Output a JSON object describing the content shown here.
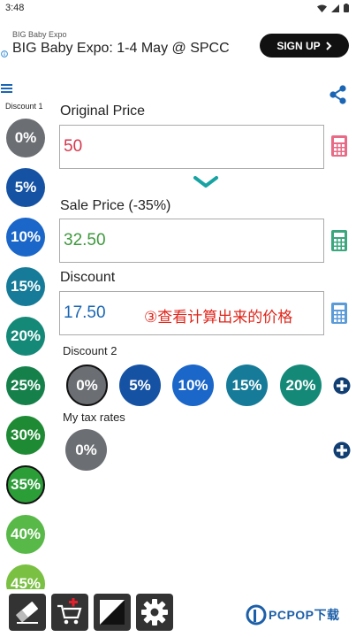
{
  "status": {
    "time": "3:48"
  },
  "ad": {
    "small_label": "BIG Baby Expo",
    "title": "BIG Baby Expo: 1-4 May @ SPCC",
    "info_icon": "info-icon",
    "cta": "SIGN UP"
  },
  "sidebar": {
    "label": "Discount 1",
    "items": [
      {
        "label": "0%",
        "color": "#6b6e72"
      },
      {
        "label": "5%",
        "color": "#1552a3"
      },
      {
        "label": "10%",
        "color": "#1a66c9"
      },
      {
        "label": "15%",
        "color": "#157b98"
      },
      {
        "label": "20%",
        "color": "#158978"
      },
      {
        "label": "25%",
        "color": "#15804a"
      },
      {
        "label": "30%",
        "color": "#1e8a33"
      },
      {
        "label": "35%",
        "color": "#2c9e38"
      },
      {
        "label": "40%",
        "color": "#58b848"
      },
      {
        "label": "45%",
        "color": "#7ac043"
      }
    ]
  },
  "fields": {
    "original_label": "Original Price",
    "original_value": "50",
    "original_color": "#d6374d",
    "sale_label": "Sale Price (-35%)",
    "sale_value": "32.50",
    "sale_color": "#3e9a3c",
    "discount_label": "Discount",
    "discount_value": "17.50",
    "discount_color": "#1a66b4"
  },
  "annotation": "③查看计算出来的价格",
  "discount2": {
    "label": "Discount 2",
    "items": [
      {
        "label": "0%",
        "color": "#6b6e72"
      },
      {
        "label": "5%",
        "color": "#1552a3"
      },
      {
        "label": "10%",
        "color": "#1a66c9"
      },
      {
        "label": "15%",
        "color": "#157b98"
      },
      {
        "label": "20%",
        "color": "#158978"
      }
    ]
  },
  "tax": {
    "label": "My tax rates",
    "items": [
      {
        "label": "0%",
        "color": "#6b6e72"
      }
    ]
  },
  "toolbar": {
    "items": [
      "eraser-icon",
      "cart-add-icon",
      "contrast-icon",
      "gear-icon"
    ]
  },
  "watermark": {
    "text": "PCPOP下载"
  }
}
